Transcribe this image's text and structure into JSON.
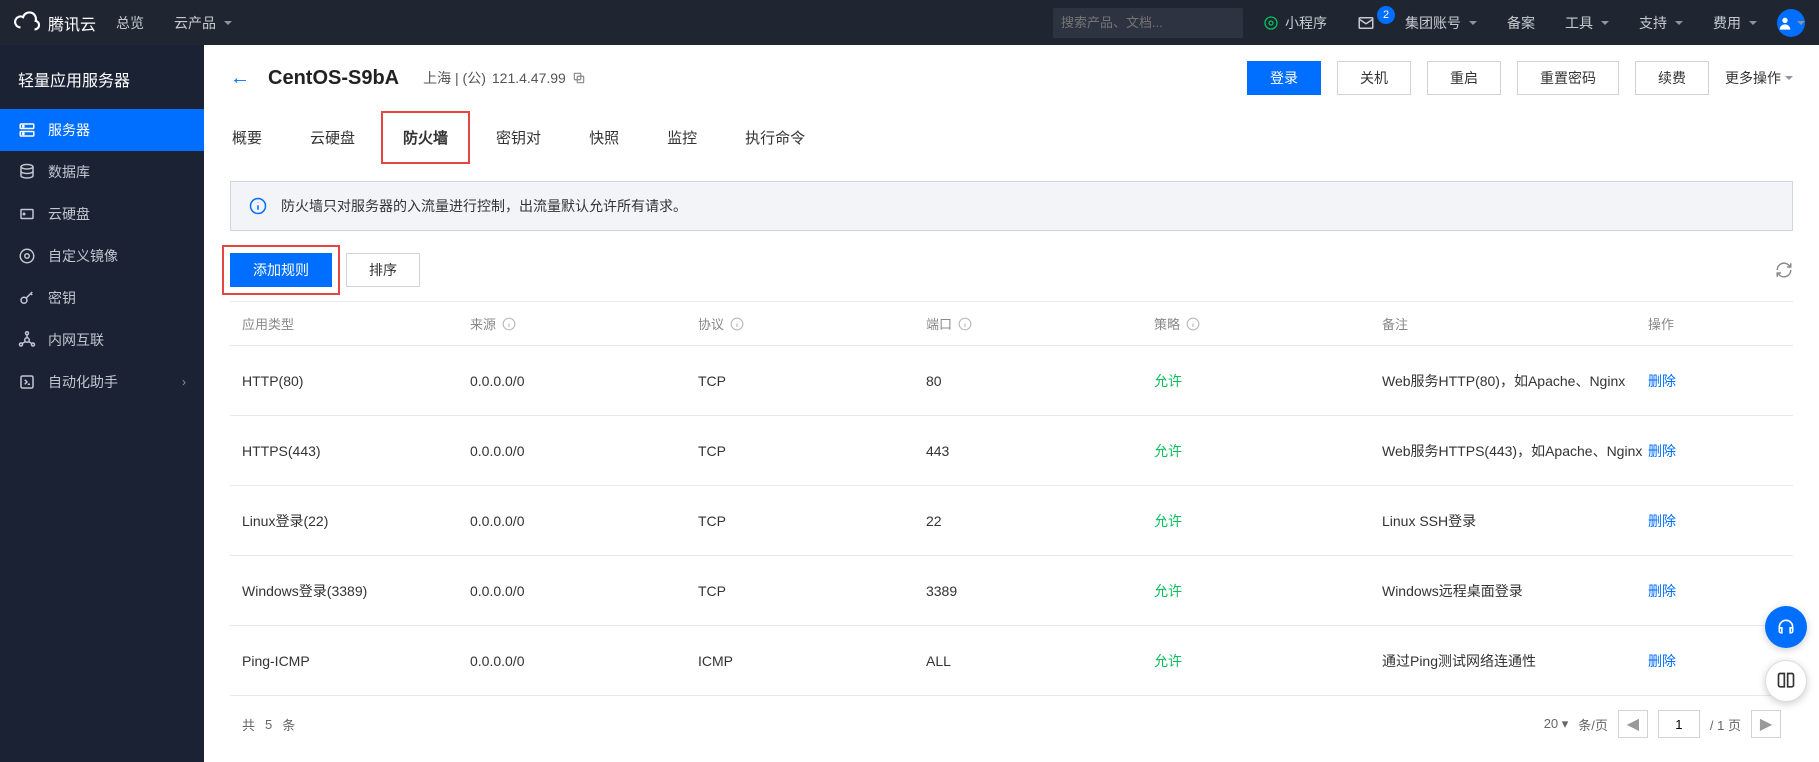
{
  "top": {
    "brand": "腾讯云",
    "overview": "总览",
    "products": "云产品",
    "searchPlaceholder": "搜索产品、文档...",
    "miniProgram": "小程序",
    "mailBadge": "2",
    "groupAccount": "集团账号",
    "beian": "备案",
    "tools": "工具",
    "support": "支持",
    "billing": "费用"
  },
  "sidebar": {
    "title": "轻量应用服务器",
    "items": [
      {
        "icon": "server",
        "label": "服务器",
        "active": true
      },
      {
        "icon": "database",
        "label": "数据库"
      },
      {
        "icon": "disk",
        "label": "云硬盘"
      },
      {
        "icon": "image",
        "label": "自定义镜像"
      },
      {
        "icon": "key",
        "label": "密钥"
      },
      {
        "icon": "network",
        "label": "内网互联"
      },
      {
        "icon": "automation",
        "label": "自动化助手",
        "chev": true
      }
    ]
  },
  "header": {
    "serverName": "CentOS-S9bA",
    "regionLabel": "上海 | (公)",
    "ip": "121.4.47.99",
    "loginBtn": "登录",
    "shutdownBtn": "关机",
    "restartBtn": "重启",
    "resetPwdBtn": "重置密码",
    "renewBtn": "续费",
    "moreOps": "更多操作"
  },
  "tabs": [
    "概要",
    "云硬盘",
    "防火墙",
    "密钥对",
    "快照",
    "监控",
    "执行命令"
  ],
  "activeTab": 2,
  "infoBar": "防火墙只对服务器的入流量进行控制，出流量默认允许所有请求。",
  "actions": {
    "addRule": "添加规则",
    "sort": "排序"
  },
  "table": {
    "columns": [
      "应用类型",
      "来源",
      "协议",
      "端口",
      "策略",
      "备注",
      "操作"
    ],
    "rows": [
      {
        "appType": "HTTP(80)",
        "source": "0.0.0.0/0",
        "protocol": "TCP",
        "port": "80",
        "policy": "允许",
        "remark": "Web服务HTTP(80)，如Apache、Nginx",
        "op": "删除"
      },
      {
        "appType": "HTTPS(443)",
        "source": "0.0.0.0/0",
        "protocol": "TCP",
        "port": "443",
        "policy": "允许",
        "remark": "Web服务HTTPS(443)，如Apache、Nginx",
        "op": "删除"
      },
      {
        "appType": "Linux登录(22)",
        "source": "0.0.0.0/0",
        "protocol": "TCP",
        "port": "22",
        "policy": "允许",
        "remark": "Linux SSH登录",
        "op": "删除"
      },
      {
        "appType": "Windows登录(3389)",
        "source": "0.0.0.0/0",
        "protocol": "TCP",
        "port": "3389",
        "policy": "允许",
        "remark": "Windows远程桌面登录",
        "op": "删除"
      },
      {
        "appType": "Ping-ICMP",
        "source": "0.0.0.0/0",
        "protocol": "ICMP",
        "port": "ALL",
        "policy": "允许",
        "remark": "通过Ping测试网络连通性",
        "op": "删除"
      }
    ],
    "totalPrefix": "共",
    "totalCount": "5",
    "totalSuffix": "条",
    "pageSize": "20",
    "perPage": "条/页",
    "currentPage": "1",
    "totalPages": "/ 1 页"
  }
}
